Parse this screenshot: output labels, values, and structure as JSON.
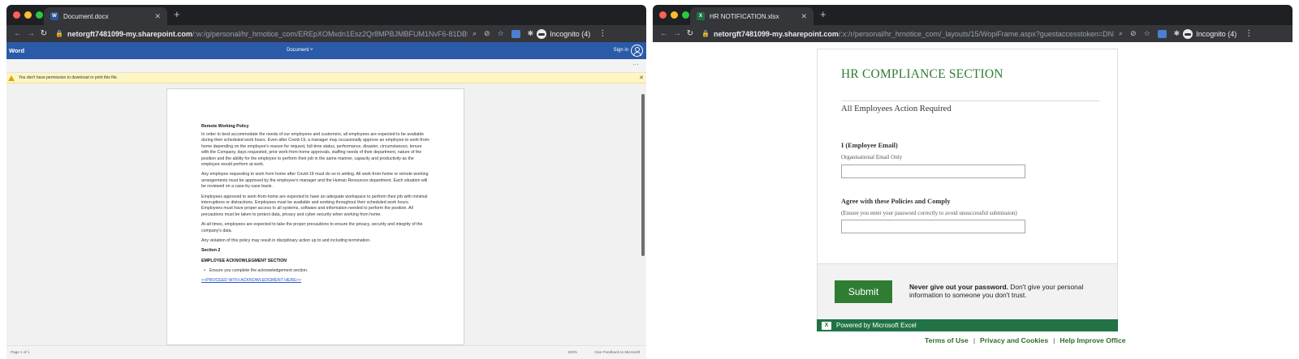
{
  "left": {
    "tab_title": "Document.docx",
    "url_host": "netorgft7481099-my.sharepoint.com",
    "url_path": "/:w:/g/personal/hr_hrnotice_com/EREpXOMxdn1Esz2Qr8MPBJMBFUM1NvF6-81DB9I-...",
    "incognito": "Incognito (4)",
    "app_name": "Word",
    "doc_label": "Document ˅",
    "signin": "Sign in",
    "warning": "You don't have permission to download or print this file.",
    "doc": {
      "heading1": "Remote Working Policy",
      "p1": "In order to best accommodate the needs of our employees and customers, all employees are expected to be available during their scheduled work hours. Even after Covid-19, a manager may occasionally approve an employee to work-from-home depending on the employee's reason for request, full-time status, performance, disaster, circumstances, tenure with the Company, days requested, prior work-from-home approvals, staffing needs of their department, nature of the position and the ability for the employee to perform their job in the same manner, capacity and productivity as the employee would perform at work.",
      "p2": "Any employee requesting to work from home after Covid-19 must do so in writing.  All work-from-home or remote working arrangements must be approved by the employee's manager and the Human Resources department.  Each situation will be reviewed on a case-by-case basis.",
      "p3": "Employees approved to work-from-home are expected to have an adequate workspace to perform their job with minimal interruptions or distractions.  Employees must be available and working throughout their scheduled work hours.  Employees must have proper access to all systems, software and information needed to perform the position.  All precautions must be taken to protect data, privacy and cyber security when working from home.",
      "p4": "At all times, employees are expected to take the proper precautions to ensure the privacy, security and integrity of the company's data.",
      "p5": "Any violation of this policy may result in disciplinary action up to and including termination.",
      "section": "Section 2",
      "heading2": "EMPLOYEE ACKNOWLEGMENT SECTION",
      "bullet": "Ensure you complete the acknowledgement section.",
      "link": "<<PROCEED WITH ACKNOWLEDGMENT HERE>>"
    },
    "status_page": "Page 1 of 1",
    "status_zoom": "100%",
    "status_feedback": "Give Feedback to Microsoft"
  },
  "right": {
    "tab_title": "HR NOTIFICATION.xlsx",
    "url_host": "netorgft7481099-my.sharepoint.com",
    "url_path": "/:x:/r/personal/hr_hrnotice_com/_layouts/15/WopiFrame.aspx?guestaccesstoken=DNh...",
    "incognito": "Incognito (4)",
    "form": {
      "title": "HR COMPLIANCE SECTION",
      "subtitle": "All Employees Action Required",
      "q1_label": "I (Employee Email)",
      "q1_hint": "Organisational Email Only",
      "q2_label": "Agree with these Policies and Comply",
      "q2_hint": "(Ensure you enter your password correctly to avoid unsuccessful submission)",
      "submit": "Submit",
      "pw_note_bold": "Never give out your password.",
      "pw_note": " Don't give your personal information to someone you don't trust."
    },
    "powered": "Powered by Microsoft Excel",
    "footer": {
      "terms": "Terms of Use",
      "privacy": "Privacy and Cookies",
      "improve": "Help Improve Office"
    }
  }
}
